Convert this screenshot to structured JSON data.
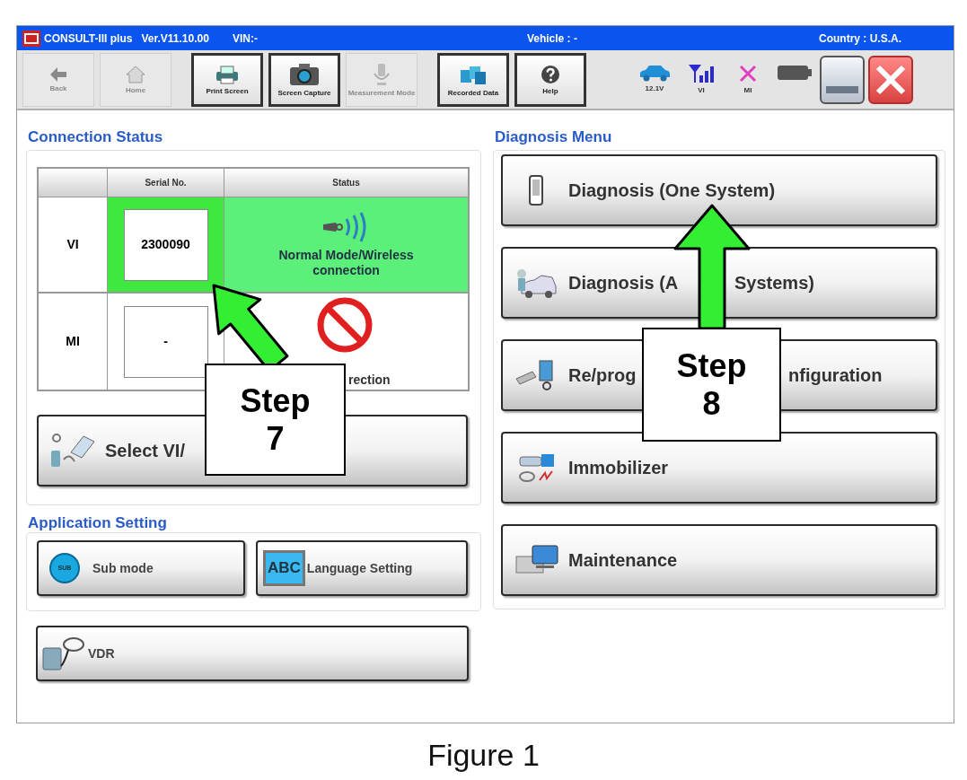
{
  "title_bar": {
    "app": "CONSULT-III plus",
    "version": "Ver.V11.10.00",
    "vin": "VIN:-",
    "vehicle": "Vehicle : -",
    "country": "Country : U.S.A."
  },
  "toolbar": [
    {
      "label": "Back",
      "kind": "back",
      "disabled": true
    },
    {
      "label": "Home",
      "kind": "home",
      "disabled": true
    },
    {
      "label": "Print Screen",
      "kind": "print",
      "disabled": false
    },
    {
      "label": "Screen Capture",
      "kind": "camera",
      "disabled": false
    },
    {
      "label": "Measurement Mode",
      "kind": "measure",
      "disabled": true
    },
    {
      "label": "Recorded Data",
      "kind": "recorded",
      "disabled": false
    },
    {
      "label": "Help",
      "kind": "help",
      "disabled": false
    }
  ],
  "status_icons": [
    {
      "label": "12.1V",
      "kind": "car"
    },
    {
      "label": "VI",
      "kind": "signal"
    },
    {
      "label": "MI",
      "kind": "cross"
    },
    {
      "kind": "battery"
    }
  ],
  "connection_status": {
    "title": "Connection Status",
    "columns": [
      "Serial No.",
      "Status"
    ],
    "rows": [
      {
        "device": "VI",
        "serial": "2300090",
        "status": "Normal Mode/Wireless connection",
        "connected": true
      },
      {
        "device": "MI",
        "serial": "-",
        "status": "rection",
        "connected": false
      }
    ],
    "select_button": "Select VI/"
  },
  "application_setting": {
    "title": "Application Setting",
    "buttons": [
      {
        "kind": "sub",
        "icon_text": "SUB",
        "label": "Sub mode"
      },
      {
        "kind": "abc",
        "icon_text": "ABC",
        "label": "Language Setting"
      }
    ]
  },
  "vdr_button": "VDR",
  "diagnosis_menu": {
    "title": "Diagnosis Menu",
    "buttons": [
      {
        "kind": "one",
        "parts": [
          "Diagnosis (One System)"
        ]
      },
      {
        "kind": "all",
        "parts": [
          "Diagnosis (A",
          "Systems)"
        ]
      },
      {
        "kind": "reprog",
        "parts": [
          "Re/prog",
          "nfiguration"
        ]
      },
      {
        "kind": "immobilizer",
        "parts": [
          "Immobilizer"
        ]
      },
      {
        "kind": "maintenance",
        "parts": [
          "Maintenance"
        ]
      }
    ]
  },
  "callouts": [
    {
      "label": "Step 7"
    },
    {
      "label": "Step 8"
    }
  ],
  "caption": "Figure 1"
}
